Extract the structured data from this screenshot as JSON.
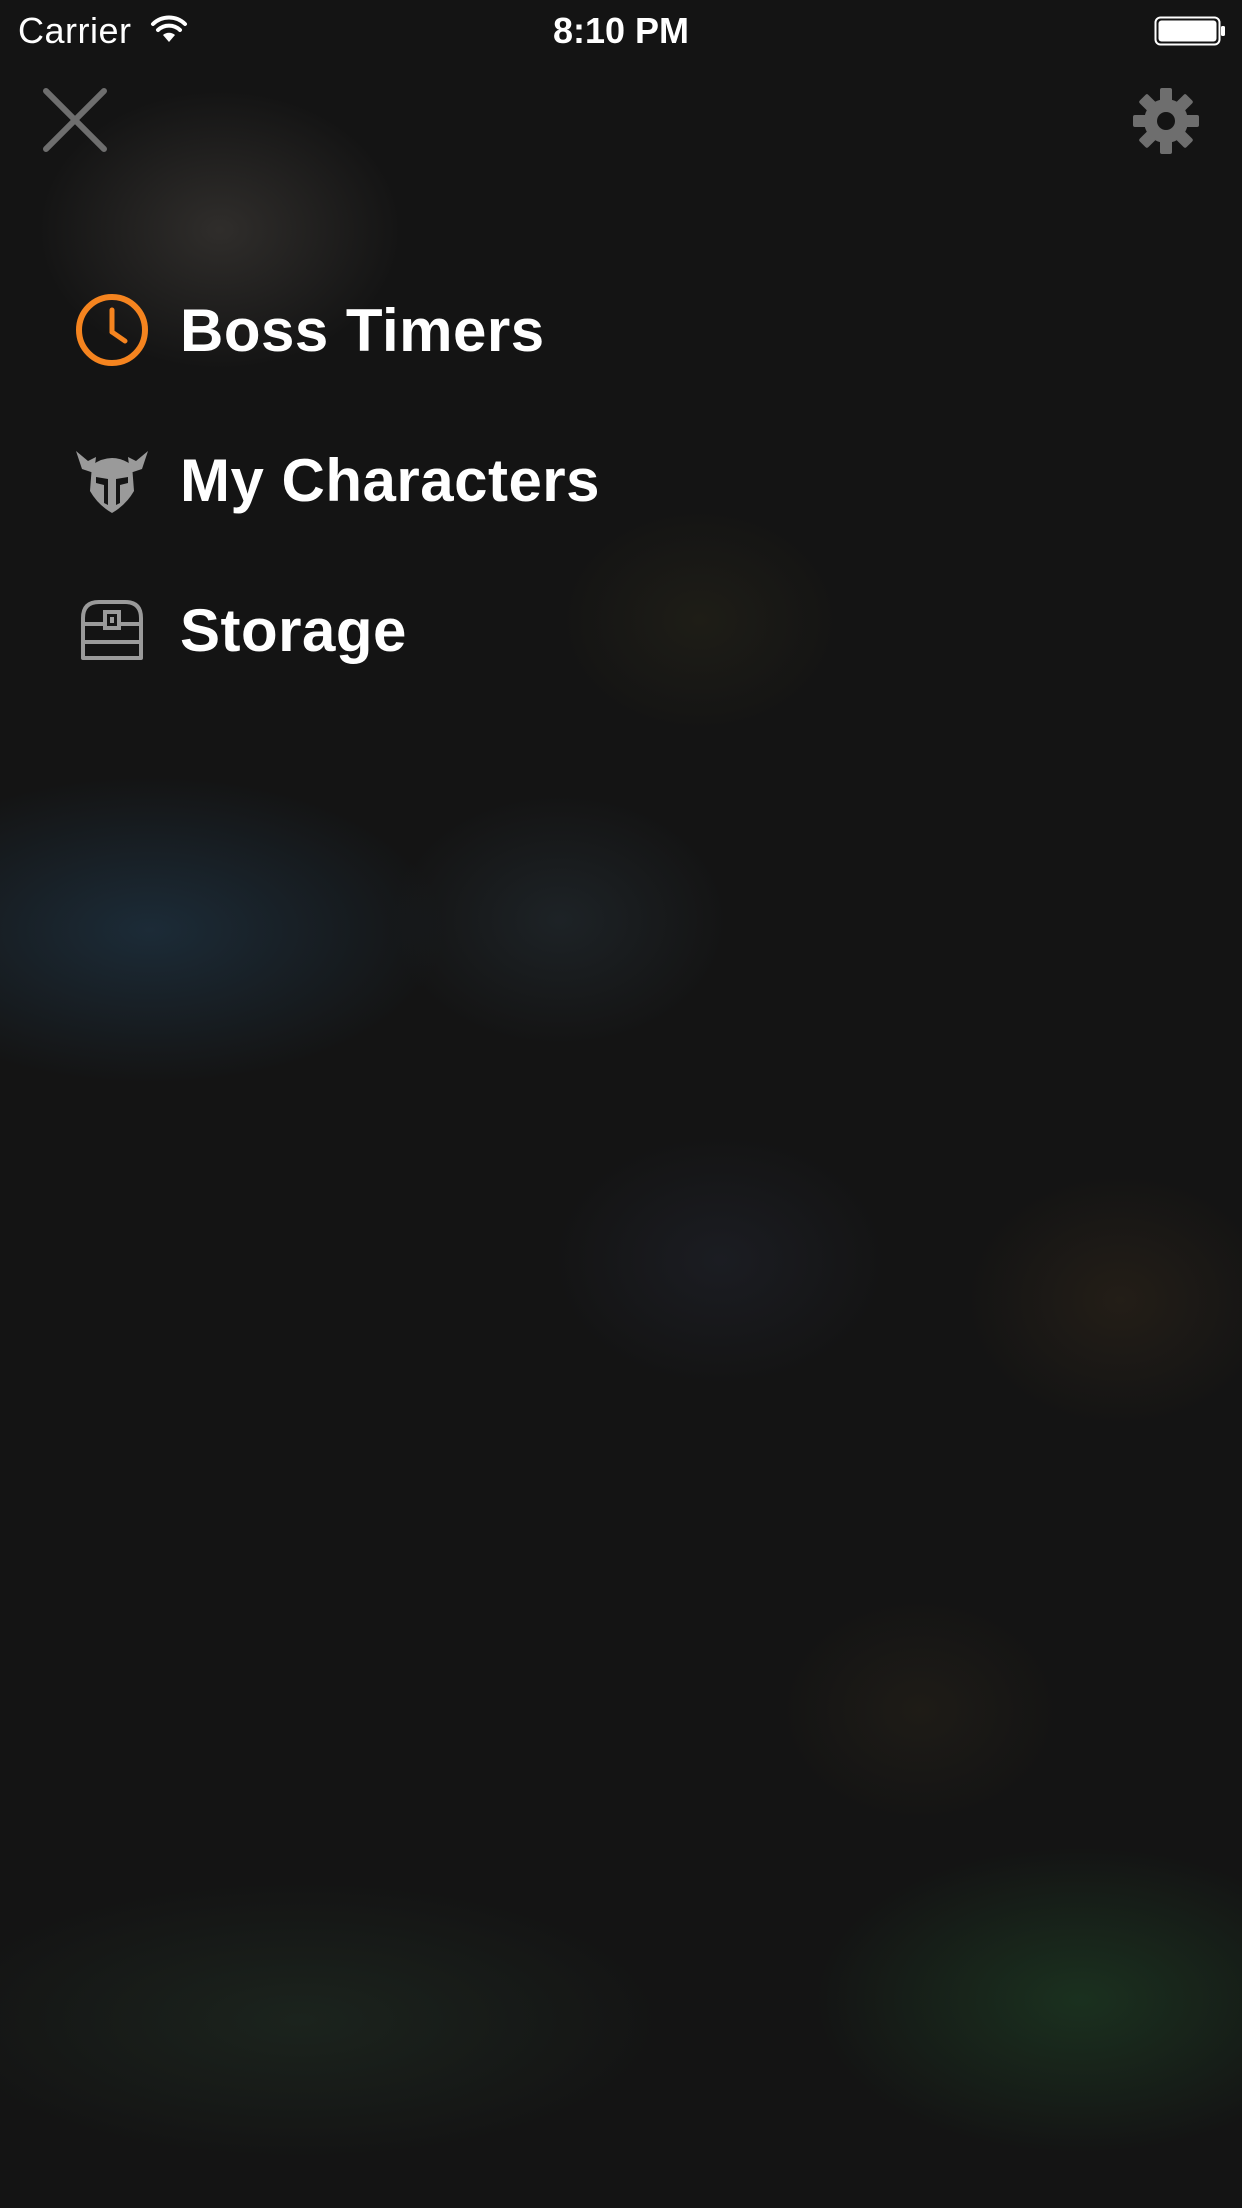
{
  "status_bar": {
    "carrier": "Carrier",
    "time": "8:10 PM",
    "wifi_icon": "wifi-icon",
    "battery_icon": "battery-icon"
  },
  "toolbar": {
    "close_icon": "close-icon",
    "settings_icon": "gear-icon"
  },
  "menu": {
    "items": [
      {
        "label": "Boss Timers",
        "icon": "clock-icon",
        "color": "#F5841F"
      },
      {
        "label": "My Characters",
        "icon": "helmet-icon",
        "color": "#9A9A9A"
      },
      {
        "label": "Storage",
        "icon": "chest-icon",
        "color": "#9A9A9A"
      }
    ]
  },
  "colors": {
    "accent": "#F5841F",
    "icon_gray": "#8A8A8A",
    "background": "#141414",
    "text": "#FFFFFF"
  }
}
